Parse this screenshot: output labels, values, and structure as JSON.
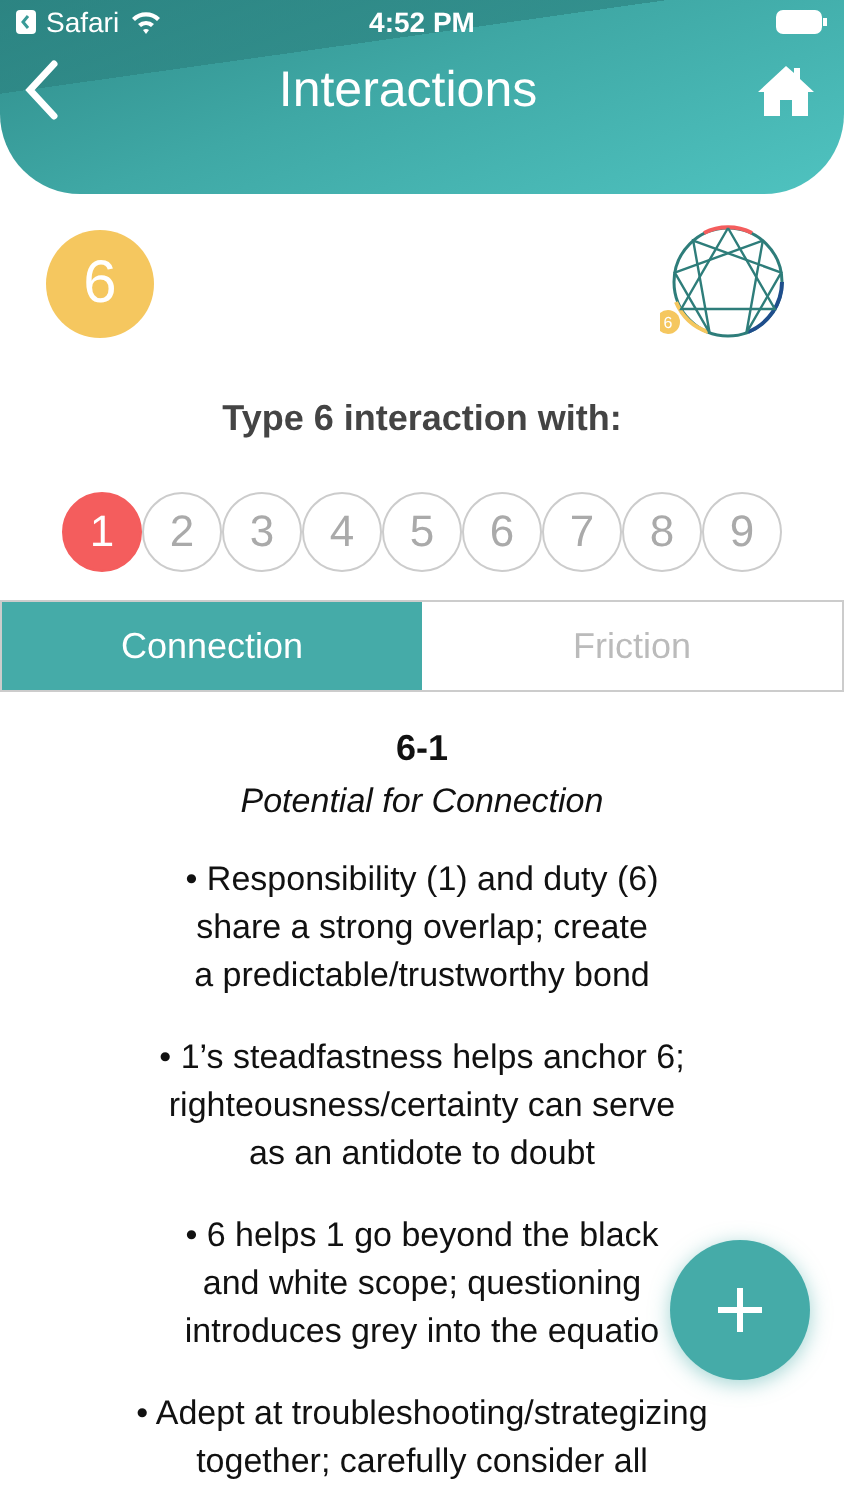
{
  "status_bar": {
    "back_app": "Safari",
    "time": "4:52 PM"
  },
  "header": {
    "title": "Interactions"
  },
  "type_badge": {
    "label": "6",
    "color": "#f5c75f"
  },
  "enneagram": {
    "badge": "6"
  },
  "prompt": "Type 6 interaction with:",
  "types": [
    {
      "label": "1",
      "selected": true
    },
    {
      "label": "2",
      "selected": false
    },
    {
      "label": "3",
      "selected": false
    },
    {
      "label": "4",
      "selected": false
    },
    {
      "label": "5",
      "selected": false
    },
    {
      "label": "6",
      "selected": false
    },
    {
      "label": "7",
      "selected": false
    },
    {
      "label": "8",
      "selected": false
    },
    {
      "label": "9",
      "selected": false
    }
  ],
  "tabs": [
    {
      "label": "Connection",
      "selected": true
    },
    {
      "label": "Friction",
      "selected": false
    }
  ],
  "content": {
    "heading": "6-1",
    "subtitle": "Potential for Connection",
    "bullets": [
      "• Responsibility (1) and duty (6)\nshare a strong overlap; create\na predictable/trustworthy bond",
      "• 1’s steadfastness helps anchor 6;\nrighteousness/certainty can serve\nas an antidote to doubt",
      "• 6 helps 1 go beyond the black\nand white scope; questioning\nintroduces grey into the equatio",
      "• Adept at troubleshooting/strategizing\ntogether; carefully consider all"
    ]
  }
}
